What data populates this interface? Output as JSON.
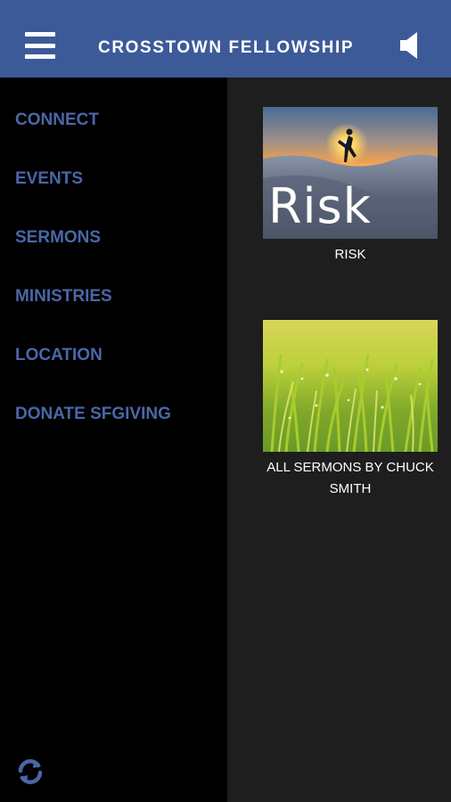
{
  "header": {
    "title": "CROSSTOWN FELLOWSHIP",
    "menu_icon": "hamburger-menu-icon",
    "speaker_icon": "speaker-icon"
  },
  "drawer": {
    "items": [
      {
        "label": "CONNECT"
      },
      {
        "label": "EVENTS"
      },
      {
        "label": "SERMONS"
      },
      {
        "label": "MINISTRIES"
      },
      {
        "label": "LOCATION"
      },
      {
        "label": "DONATE SFGIVING"
      }
    ],
    "refresh_icon": "refresh-icon"
  },
  "content": {
    "cards": [
      {
        "title": "RISK",
        "thumb_text": "Risk"
      },
      {
        "title": "ALL SERMONS BY CHUCK SMITH"
      }
    ]
  },
  "colors": {
    "header_bg": "#3d5a98",
    "drawer_text": "#4b66a8",
    "drawer_bg": "#000000",
    "content_bg": "#1e1e1e"
  }
}
